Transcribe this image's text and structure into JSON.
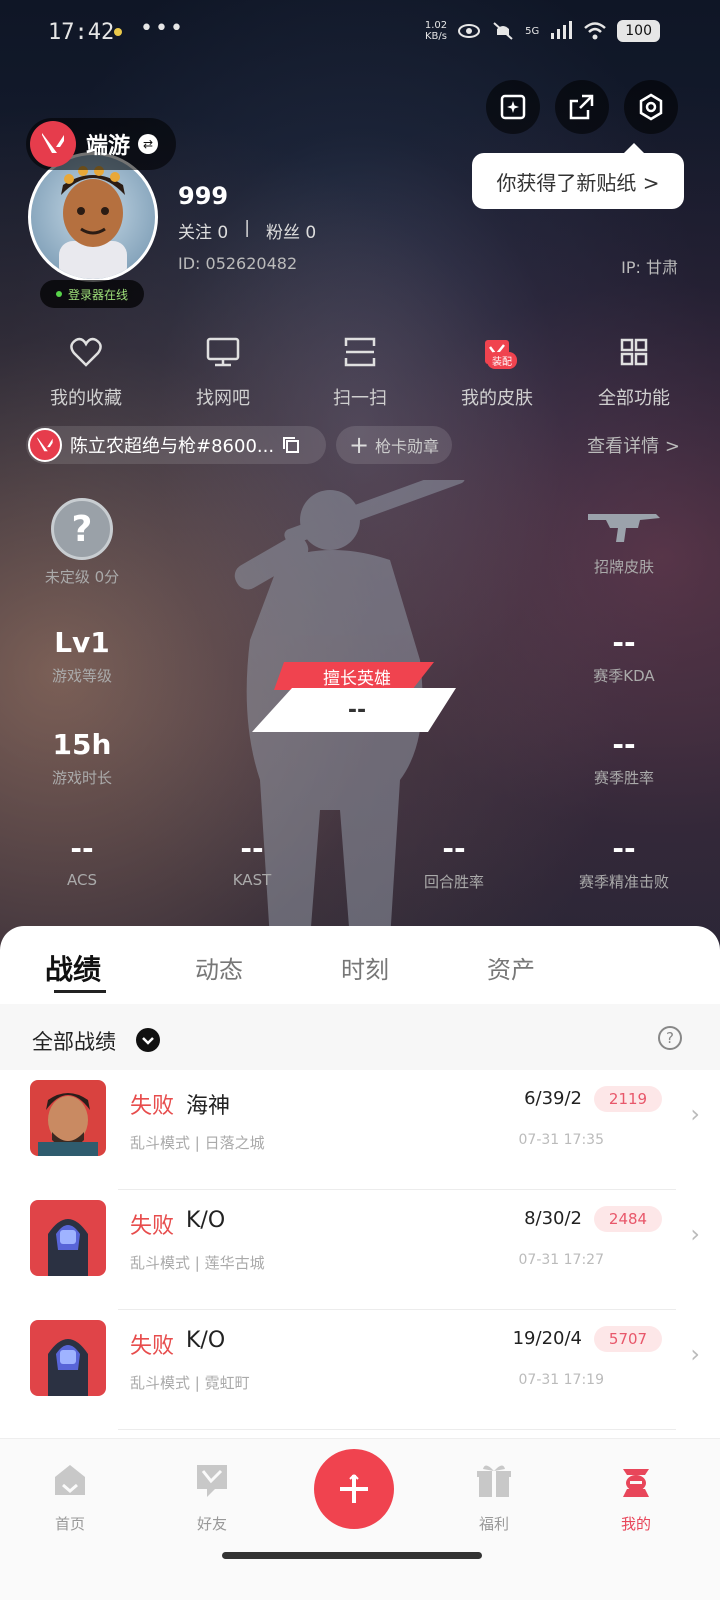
{
  "status_bar": {
    "time": "17:42",
    "more": "•••",
    "speed": "1.02\nKB/s",
    "network": "5G",
    "battery": "100"
  },
  "header": {
    "sticker_tip": "你获得了新贴纸 >",
    "game_name": "端游",
    "online_status": "登录器在线",
    "username": "999",
    "following": "关注 0",
    "followers": "粉丝 0",
    "user_id": "ID: 052620482",
    "ip": "IP: 甘肃"
  },
  "quick_menu": [
    {
      "label": "我的收藏",
      "icon": "heart-icon"
    },
    {
      "label": "找网吧",
      "icon": "monitor-icon"
    },
    {
      "label": "扫一扫",
      "icon": "scan-icon"
    },
    {
      "label": "我的皮肤",
      "icon": "skin-icon",
      "badge": "装配"
    },
    {
      "label": "全部功能",
      "icon": "grid-icon"
    }
  ],
  "title_row": {
    "title": "陈立农超绝与枪#8600...",
    "card_badge": "枪卡勋章",
    "details": "查看详情"
  },
  "stats": {
    "rank": {
      "symbol": "?",
      "label": "未定级 0分"
    },
    "signature_skin": {
      "label": "招牌皮肤"
    },
    "level": {
      "value": "Lv1",
      "label": "游戏等级"
    },
    "season_kda": {
      "value": "--",
      "label": "赛季KDA"
    },
    "play_time": {
      "value": "15h",
      "label": "游戏时长"
    },
    "season_winrate": {
      "value": "--",
      "label": "赛季胜率"
    },
    "acs": {
      "value": "--",
      "label": "ACS"
    },
    "kast": {
      "value": "--",
      "label": "KAST"
    },
    "round_winrate": {
      "value": "--",
      "label": "回合胜率"
    },
    "precision_kills": {
      "value": "--",
      "label": "赛季精准击败"
    },
    "best_hero_label": "擅长英雄",
    "best_hero_value": "--"
  },
  "tabs": [
    "战绩",
    "动态",
    "时刻",
    "资产"
  ],
  "filter": {
    "label": "全部战绩",
    "help": "?"
  },
  "matches": [
    {
      "result": "失败",
      "agent": "海神",
      "kda": "6/39/2",
      "score": "2119",
      "mode": "乱斗模式 | 日落之城",
      "time": "07-31 17:35"
    },
    {
      "result": "失败",
      "agent": "K/O",
      "kda": "8/30/2",
      "score": "2484",
      "mode": "乱斗模式 | 莲华古城",
      "time": "07-31 17:27"
    },
    {
      "result": "失败",
      "agent": "K/O",
      "kda": "19/20/4",
      "score": "5707",
      "mode": "乱斗模式 | 霓虹町",
      "time": "07-31 17:19"
    }
  ],
  "bottom_nav": [
    {
      "label": "首页",
      "icon": "home-icon"
    },
    {
      "label": "好友",
      "icon": "friends-icon"
    },
    {
      "label": "福利",
      "icon": "gift-icon"
    },
    {
      "label": "我的",
      "icon": "profile-icon"
    }
  ],
  "colors": {
    "accent": "#f0434f",
    "loss": "#e74c4c",
    "score_bg": "#fde7e8"
  }
}
